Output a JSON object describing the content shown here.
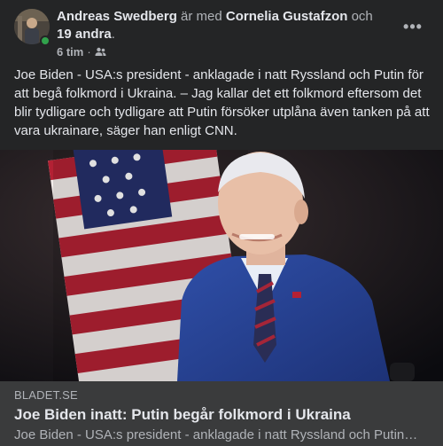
{
  "header": {
    "author": "Andreas Swedberg",
    "with_text": "är med",
    "tagged": "Cornelia Gustafzon",
    "and_text": "och",
    "others": "19 andra",
    "period": ".",
    "time": "6 tim",
    "separator": "·",
    "audience_icon": "friends-icon",
    "more_icon": "more-horizontal-icon",
    "more_label": "•••"
  },
  "post": {
    "text": "Joe Biden - USA:s president - anklagade i natt Ryssland och Putin för att begå folkmord i Ukraina. – Jag kallar det ett folkmord eftersom det blir tydligare och tydligare att Putin försöker utplåna även tanken på att vara ukrainare, säger han enligt CNN."
  },
  "link": {
    "domain": "BLADET.SE",
    "title": "Joe Biden inatt: Putin begår folkmord i Ukraina",
    "description": "Joe Biden - USA:s president - anklagade i natt Ryssland och Putin för att begå folkmord i Ukraina."
  },
  "colors": {
    "background": "#242526",
    "card": "#3a3b3c",
    "text": "#e4e6eb",
    "secondary": "#b0b3b8",
    "online": "#31a24c"
  }
}
